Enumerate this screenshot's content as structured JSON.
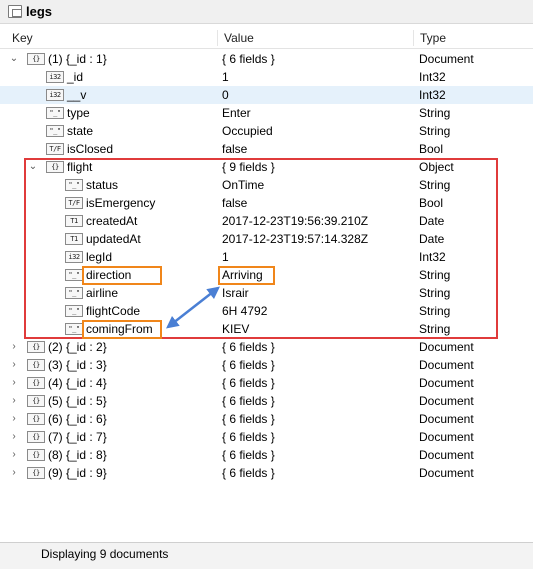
{
  "window": {
    "title": "legs"
  },
  "columns": {
    "key": "Key",
    "value": "Value",
    "type": "Type"
  },
  "rows": [
    {
      "key": "(1) {_id : 1}",
      "value": "{ 6 fields }",
      "type": "Document",
      "icon": "{}",
      "expand": "open"
    },
    {
      "key": "_id",
      "value": "1",
      "type": "Int32",
      "icon": "i32"
    },
    {
      "key": "__v",
      "value": "0",
      "type": "Int32",
      "icon": "i32"
    },
    {
      "key": "type",
      "value": "Enter",
      "type": "String",
      "icon": "\"_\""
    },
    {
      "key": "state",
      "value": "Occupied",
      "type": "String",
      "icon": "\"_\""
    },
    {
      "key": "isClosed",
      "value": "false",
      "type": "Bool",
      "icon": "T/F"
    },
    {
      "key": "flight",
      "value": "{ 9 fields }",
      "type": "Object",
      "icon": "{}",
      "expand": "open"
    },
    {
      "key": "status",
      "value": "OnTime",
      "type": "String",
      "icon": "\"_\""
    },
    {
      "key": "isEmergency",
      "value": "false",
      "type": "Bool",
      "icon": "T/F"
    },
    {
      "key": "createdAt",
      "value": "2017-12-23T19:56:39.210Z",
      "type": "Date",
      "icon": "T1"
    },
    {
      "key": "updatedAt",
      "value": "2017-12-23T19:57:14.328Z",
      "type": "Date",
      "icon": "T1"
    },
    {
      "key": "legId",
      "value": "1",
      "type": "Int32",
      "icon": "i32"
    },
    {
      "key": "direction",
      "value": "Arriving",
      "type": "String",
      "icon": "\"_\""
    },
    {
      "key": "airline",
      "value": "Israir",
      "type": "String",
      "icon": "\"_\""
    },
    {
      "key": "flightCode",
      "value": "6H 4792",
      "type": "String",
      "icon": "\"_\""
    },
    {
      "key": "comingFrom",
      "value": "KIEV",
      "type": "String",
      "icon": "\"_\""
    },
    {
      "key": "(2) {_id : 2}",
      "value": "{ 6 fields }",
      "type": "Document",
      "icon": "{}",
      "expand": "closed"
    },
    {
      "key": "(3) {_id : 3}",
      "value": "{ 6 fields }",
      "type": "Document",
      "icon": "{}",
      "expand": "closed"
    },
    {
      "key": "(4) {_id : 4}",
      "value": "{ 6 fields }",
      "type": "Document",
      "icon": "{}",
      "expand": "closed"
    },
    {
      "key": "(5) {_id : 5}",
      "value": "{ 6 fields }",
      "type": "Document",
      "icon": "{}",
      "expand": "closed"
    },
    {
      "key": "(6) {_id : 6}",
      "value": "{ 6 fields }",
      "type": "Document",
      "icon": "{}",
      "expand": "closed"
    },
    {
      "key": "(7) {_id : 7}",
      "value": "{ 6 fields }",
      "type": "Document",
      "icon": "{}",
      "expand": "closed"
    },
    {
      "key": "(8) {_id : 8}",
      "value": "{ 6 fields }",
      "type": "Document",
      "icon": "{}",
      "expand": "closed"
    },
    {
      "key": "(9) {_id : 9}",
      "value": "{ 6 fields }",
      "type": "Document",
      "icon": "{}",
      "expand": "closed"
    }
  ],
  "status": {
    "text": "Displaying 9 documents"
  },
  "colors": {
    "highlight_red": "#e03b3b",
    "highlight_orange": "#f0861a",
    "arrow": "#4a7fd4",
    "selected_row": "#e5f1fb"
  }
}
